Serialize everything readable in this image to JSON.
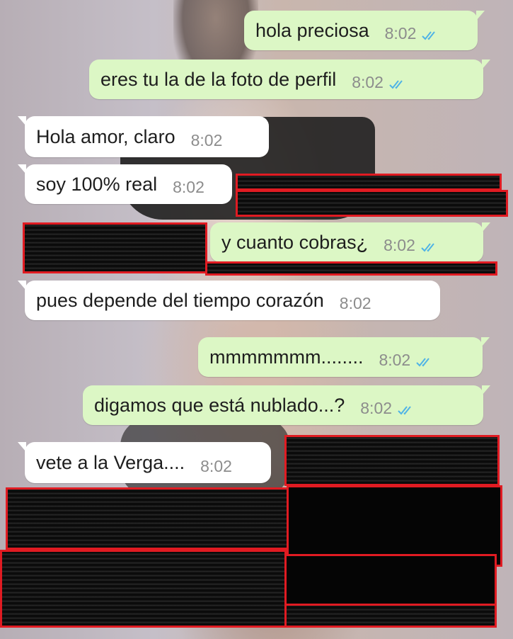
{
  "colors": {
    "outgoing_bubble": "#dcf7c5",
    "incoming_bubble": "#ffffff",
    "read_ticks": "#4fb3e6",
    "redaction_border": "#e01b22"
  },
  "messages": [
    {
      "direction": "out",
      "text": "hola preciosa",
      "time": "8:02",
      "status": "read"
    },
    {
      "direction": "out",
      "text": "eres tu la de la foto de perfil",
      "time": "8:02",
      "status": "read"
    },
    {
      "direction": "in",
      "text": "Hola amor,  claro",
      "time": "8:02"
    },
    {
      "direction": "in",
      "text": "soy 100% real",
      "time": "8:02"
    },
    {
      "direction": "out",
      "text": "y cuanto cobras¿",
      "time": "8:02",
      "status": "read"
    },
    {
      "direction": "in",
      "text": "pues depende del tiempo corazón",
      "time": "8:02"
    },
    {
      "direction": "out",
      "text": "mmmmmmm........",
      "time": "8:02",
      "status": "read"
    },
    {
      "direction": "out",
      "text": "digamos que está nublado...?",
      "time": "8:02",
      "status": "read"
    },
    {
      "direction": "in",
      "text": "vete a la Verga....",
      "time": "8:02"
    }
  ]
}
